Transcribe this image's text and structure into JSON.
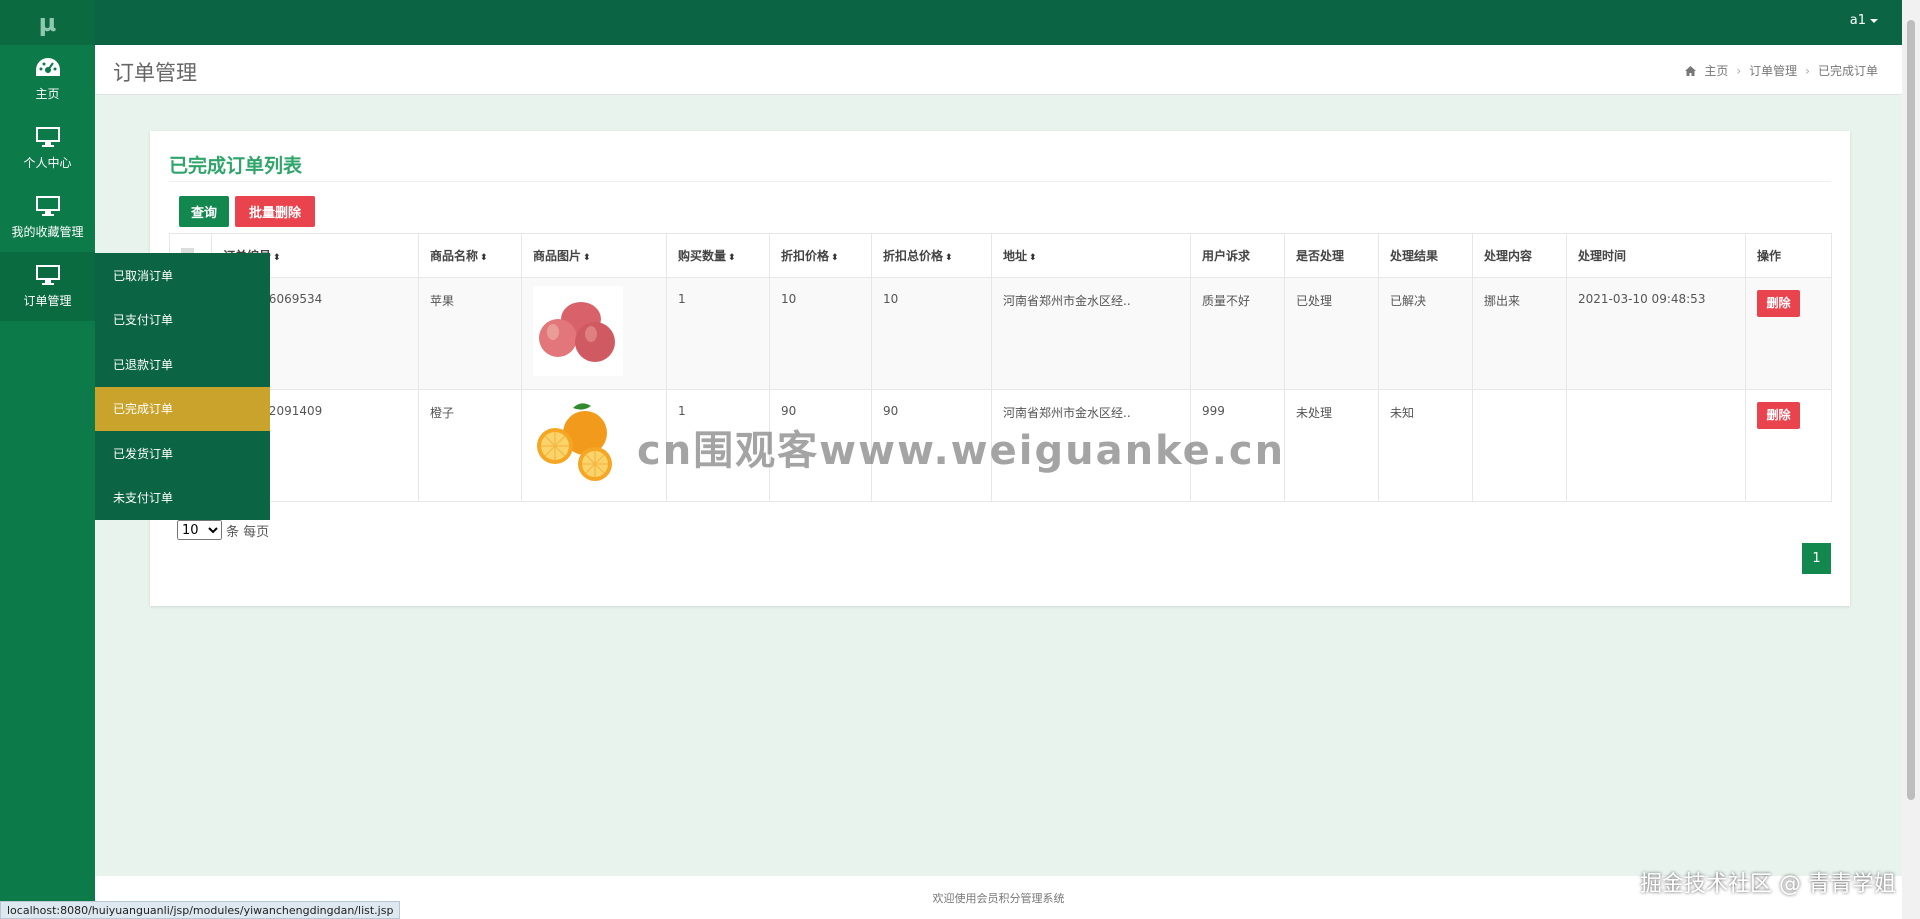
{
  "sidebar": {
    "logo": "µ",
    "items": [
      {
        "label": "主页",
        "icon": "dashboard-icon"
      },
      {
        "label": "个人中心",
        "icon": "monitor-icon"
      },
      {
        "label": "我的收藏管理",
        "icon": "monitor-icon"
      },
      {
        "label": "订单管理",
        "icon": "monitor-icon"
      }
    ]
  },
  "topbar": {
    "user": "a1"
  },
  "header": {
    "title": "订单管理",
    "breadcrumb": [
      "主页",
      "订单管理",
      "已完成订单"
    ]
  },
  "submenu": {
    "items": [
      "已取消订单",
      "已支付订单",
      "已退款订单",
      "已完成订单",
      "已发货订单",
      "未支付订单"
    ],
    "active_index": 3
  },
  "card": {
    "title": "已完成订单列表",
    "query_button": "查询",
    "batch_delete_button": "批量删除"
  },
  "table": {
    "headers": [
      "订单编号",
      "商品名称",
      "商品图片",
      "购买数量",
      "折扣价格",
      "折扣总价格",
      "地址",
      "用户诉求",
      "是否处理",
      "处理结果",
      "处理内容",
      "处理时间",
      "操作"
    ],
    "rows": [
      {
        "order_no": "9394296069534",
        "name": "苹果",
        "image": "apple",
        "qty": "1",
        "price": "10",
        "total": "10",
        "address": "河南省郑州市金水区经..",
        "appeal": "质量不好",
        "handled": "已处理",
        "result": "已解决",
        "content": "挪出来",
        "time": "2021-03-10 09:48:53",
        "action": "删除"
      },
      {
        "order_no": "9384962091409",
        "name": "橙子",
        "image": "orange",
        "qty": "1",
        "price": "90",
        "total": "90",
        "address": "河南省郑州市金水区经..",
        "appeal": "999",
        "handled": "未处理",
        "result": "未知",
        "content": "",
        "time": "",
        "action": "删除"
      }
    ]
  },
  "pagination": {
    "page_size": "10",
    "page_size_suffix": "条 每页",
    "current_page": "1"
  },
  "watermark": "cn围观客www.weiguanke.cn",
  "footer": "欢迎使用会员积分管理系统",
  "status_url": "localhost:8080/huiyuanguanli/jsp/modules/yiwanchengdingdan/list.jsp",
  "credit": "掘金技术社区 @ 青青学姐",
  "colors": {
    "sidebar": "#0d7a4a",
    "topbar": "#0b6444",
    "accent": "#30a56b",
    "active_submenu": "#c9a32b",
    "danger": "#e9434d",
    "primary": "#12884f"
  }
}
